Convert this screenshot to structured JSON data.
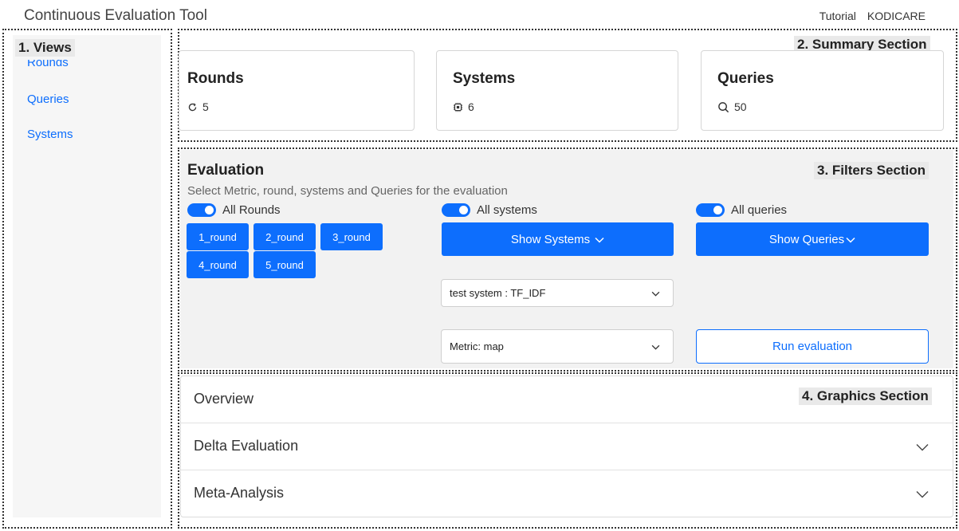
{
  "header": {
    "title": "Continuous Evaluation Tool",
    "links": [
      "Tutorial",
      "KODICARE"
    ]
  },
  "regions": {
    "views": "1. Views",
    "summary": "2. Summary Section",
    "filters": "3. Filters Section",
    "graphics": "4. Graphics Section"
  },
  "sidebar": {
    "items": [
      {
        "label": "Rounds"
      },
      {
        "label": "Queries"
      },
      {
        "label": "Systems"
      }
    ]
  },
  "summary": {
    "cards": [
      {
        "title": "Rounds",
        "value": "5",
        "icon": "refresh-icon"
      },
      {
        "title": "Systems",
        "value": "6",
        "icon": "cpu-icon"
      },
      {
        "title": "Queries",
        "value": "50",
        "icon": "search-icon"
      }
    ]
  },
  "filters": {
    "title": "Evaluation",
    "subtitle": "Select Metric, round, systems and Queries for the evaluation",
    "toggles": {
      "rounds": "All Rounds",
      "systems": "All systems",
      "queries": "All queries"
    },
    "rounds": [
      "1_round",
      "2_round",
      "3_round",
      "4_round",
      "5_round"
    ],
    "show_systems": "Show Systems",
    "show_queries": "Show Queries",
    "test_system": "test system : TF_IDF",
    "metric": "Metric: map",
    "run": "Run evaluation"
  },
  "graphics": {
    "items": [
      {
        "label": "Overview",
        "chevron": false
      },
      {
        "label": "Delta Evaluation",
        "chevron": true
      },
      {
        "label": "Meta-Analysis",
        "chevron": true
      }
    ]
  },
  "colors": {
    "accent": "#0d6efd"
  }
}
